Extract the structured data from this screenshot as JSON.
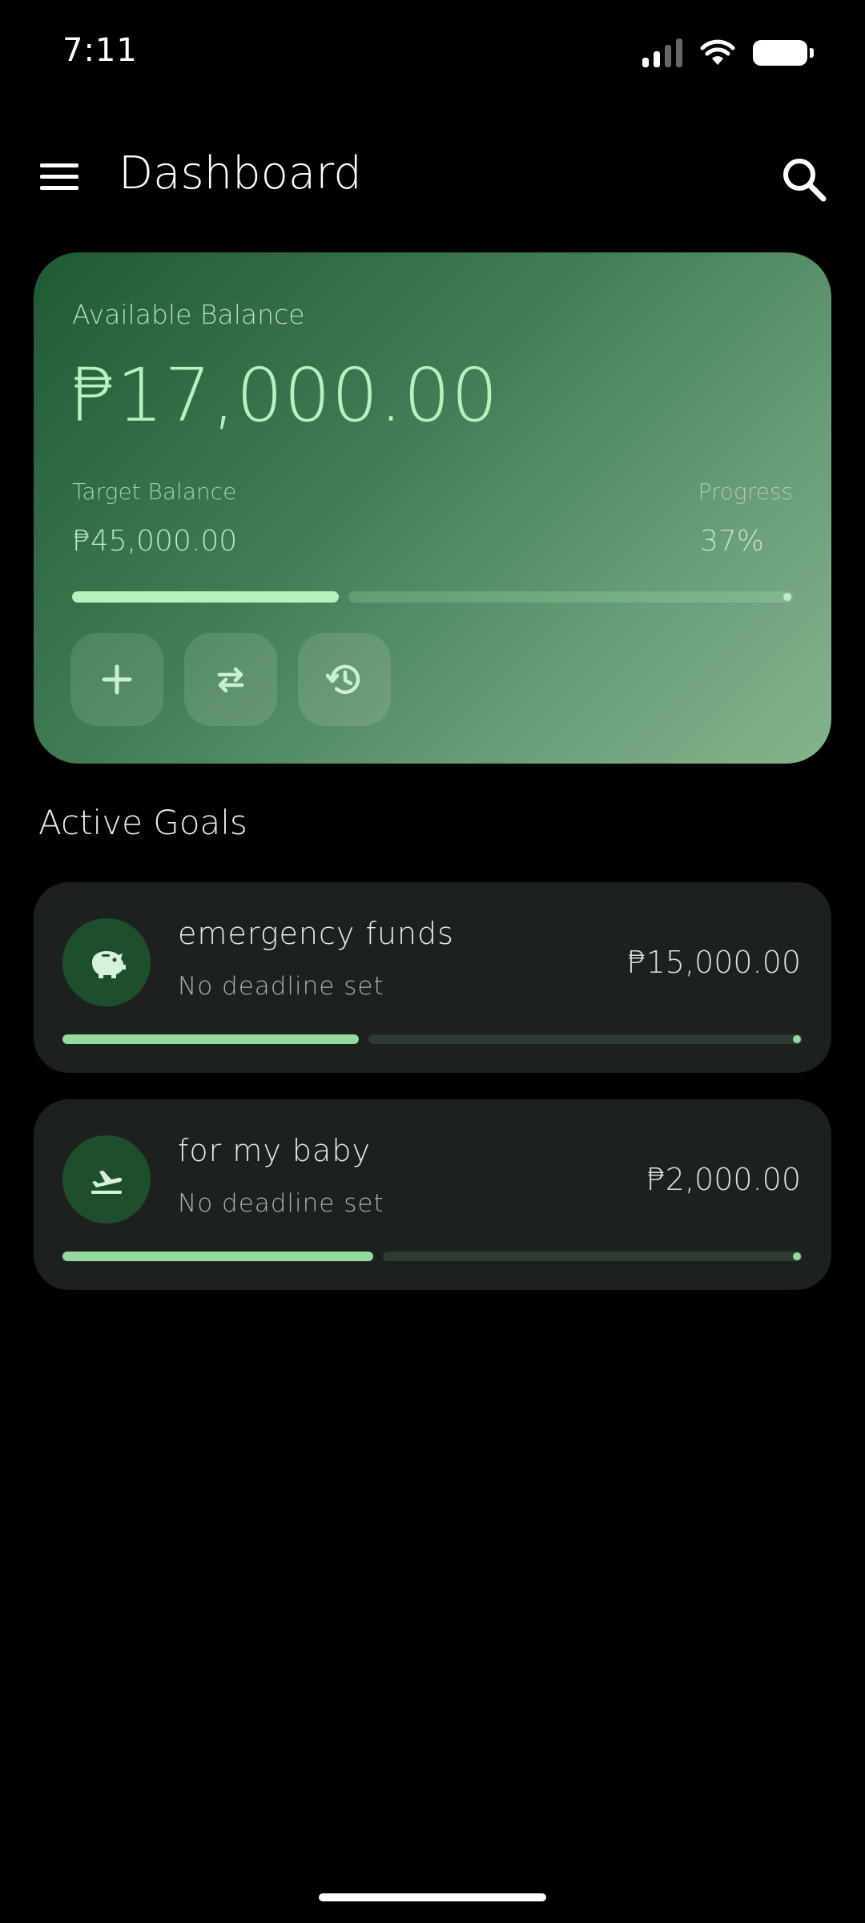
{
  "status_bar": {
    "time": "7:11",
    "icons": [
      "signal-icon",
      "wifi-icon",
      "battery-icon"
    ]
  },
  "app_bar": {
    "title": "Dashboard",
    "menu_icon": "menu-icon",
    "search_icon": "search-icon"
  },
  "balance_card": {
    "available_label": "Available Balance",
    "available_amount": "₱17,000.00",
    "target_label": "Target Balance",
    "target_amount": "₱45,000.00",
    "progress_label": "Progress",
    "progress_value": "37%",
    "progress_fraction": 0.37,
    "actions": [
      {
        "icon": "plus-icon"
      },
      {
        "icon": "transfer-icon"
      },
      {
        "icon": "history-icon"
      }
    ],
    "gradient": [
      "#1f5a33",
      "#84b48e"
    ],
    "accent": "#b6f1be"
  },
  "goals": {
    "section_title": "Active Goals",
    "items": [
      {
        "name": "emergency funds",
        "deadline": "No deadline set",
        "amount": "₱15,000.00",
        "icon": "piggy-bank-icon",
        "progress_fraction": 0.4
      },
      {
        "name": "for my baby",
        "deadline": "No deadline set",
        "amount": "₱2,000.00",
        "icon": "airplane-takeoff-icon",
        "progress_fraction": 0.42
      }
    ]
  }
}
